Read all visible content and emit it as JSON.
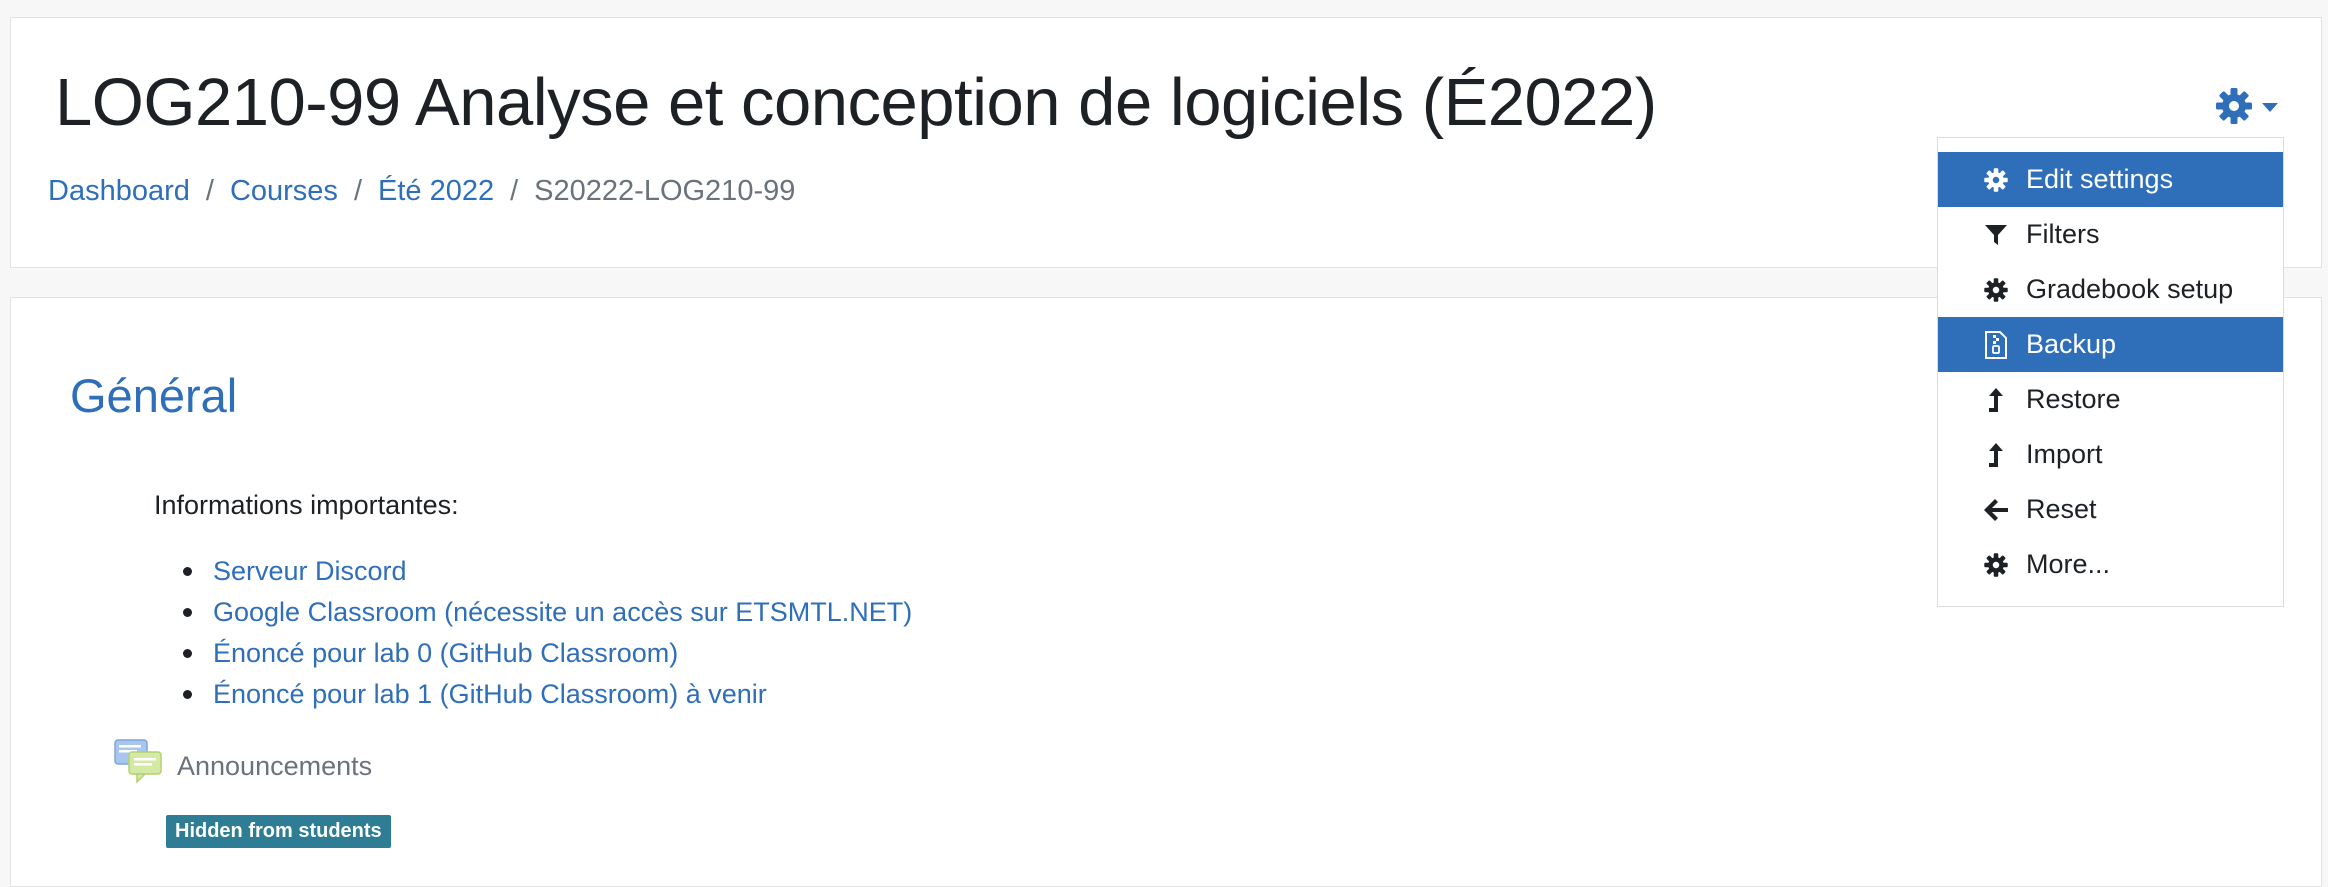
{
  "header": {
    "course_title": "LOG210-99 Analyse et conception de logiciels (É2022)",
    "breadcrumb": [
      {
        "label": "Dashboard"
      },
      {
        "label": "Courses"
      },
      {
        "label": "Été 2022"
      },
      {
        "label": "S20222-LOG210-99"
      }
    ],
    "settings_icon": "gear-icon",
    "dropdown_caret_icon": "caret-down-icon"
  },
  "action_menu": {
    "items": [
      {
        "label": "Edit settings",
        "icon": "gear-icon",
        "highlighted": true
      },
      {
        "label": "Filters",
        "icon": "filter-icon",
        "highlighted": false
      },
      {
        "label": "Gradebook setup",
        "icon": "gear-icon",
        "highlighted": false
      },
      {
        "label": "Backup",
        "icon": "file-archive-icon",
        "highlighted": true
      },
      {
        "label": "Restore",
        "icon": "level-up-icon",
        "highlighted": false
      },
      {
        "label": "Import",
        "icon": "level-up-icon",
        "highlighted": false
      },
      {
        "label": "Reset",
        "icon": "arrow-left-icon",
        "highlighted": false
      },
      {
        "label": "More...",
        "icon": "gear-icon",
        "highlighted": false
      }
    ]
  },
  "section": {
    "title": "Général",
    "info_heading": "Informations importantes:",
    "links": [
      {
        "label": "Serveur Discord"
      },
      {
        "label": "Google Classroom (nécessite un accès sur ETSMTL.NET)"
      },
      {
        "label": "Énoncé pour lab 0 (GitHub Classroom)"
      },
      {
        "label": "Énoncé pour lab 1 (GitHub Classroom) à venir"
      }
    ],
    "announcements": {
      "label": "Announcements",
      "icon": "forum-icon",
      "badge": "Hidden from students"
    }
  },
  "colors": {
    "link": "#2f6fba",
    "menu_highlight": "#2f6fba",
    "badge": "#2e7d94"
  }
}
